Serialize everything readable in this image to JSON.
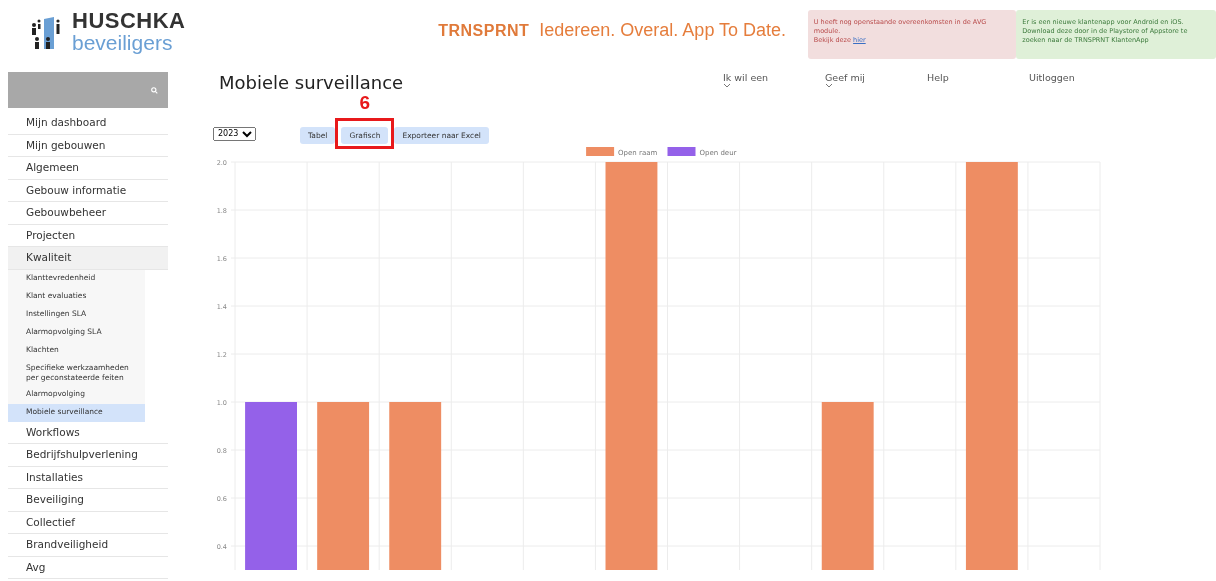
{
  "header": {
    "logo": {
      "name": "HUSCHKA",
      "subtitle": "beveiligers"
    },
    "slogan": {
      "brand": "TRNSPRNT",
      "text": "Iedereen. Overal. App To Date."
    },
    "alerts": [
      {
        "kind": "danger",
        "text": "U heeft nog openstaande overeenkomsten in de AVG module.",
        "link_prefix": "Bekijk deze",
        "link": "hier"
      },
      {
        "kind": "success",
        "text": "Er is een nieuwe klantenapp voor Android en iOS. Download deze door in de Playstore of Appstore te zoeken naar de TRNSPRNT KlantenApp"
      }
    ]
  },
  "sidebar": {
    "items": [
      {
        "label": "Mijn dashboard",
        "selected": false
      },
      {
        "label": "Mijn gebouwen",
        "selected": false
      },
      {
        "label": "Algemeen",
        "selected": false
      },
      {
        "label": "Gebouw informatie",
        "selected": false
      },
      {
        "label": "Gebouwbeheer",
        "selected": false
      },
      {
        "label": "Projecten",
        "selected": false
      },
      {
        "label": "Kwaliteit",
        "selected": false,
        "expanded": true,
        "children": [
          {
            "label": "Klanttevredenheid",
            "selected": false
          },
          {
            "label": "Klant evaluaties",
            "selected": false
          },
          {
            "label": "Instellingen SLA",
            "selected": false
          },
          {
            "label": "Alarmopvolging SLA",
            "selected": false
          },
          {
            "label": "Klachten",
            "selected": false
          },
          {
            "label": "Specifieke werkzaamheden per geconstateerde feiten",
            "selected": false
          },
          {
            "label": "Alarmopvolging",
            "selected": false
          },
          {
            "label": "Mobiele surveillance",
            "selected": true
          }
        ]
      },
      {
        "label": "Workflows",
        "selected": false
      },
      {
        "label": "Bedrijfshulpverlening",
        "selected": false
      },
      {
        "label": "Installaties",
        "selected": false
      },
      {
        "label": "Beveiliging",
        "selected": false
      },
      {
        "label": "Collectief",
        "selected": false
      },
      {
        "label": "Brandveiligheid",
        "selected": false
      },
      {
        "label": "Avg",
        "selected": false
      }
    ]
  },
  "nav": [
    {
      "label": "Ik wil een",
      "dropdown": true
    },
    {
      "label": "Geef mij",
      "dropdown": true
    },
    {
      "label": "Help",
      "dropdown": false
    },
    {
      "label": "Uitloggen",
      "dropdown": false
    }
  ],
  "page": {
    "title": "Mobiele surveillance",
    "year_select": {
      "value": "2023"
    },
    "view_buttons": [
      {
        "label": "Tabel"
      },
      {
        "label": "Grafisch",
        "annotation": "6"
      },
      {
        "label": "Exporteer naar Excel"
      }
    ],
    "chart": {
      "chart_data": {
        "type": "bar",
        "grid": true,
        "legend": "top",
        "ylim": [
          0.3,
          2
        ],
        "yticks": [
          {
            "value": 0.4,
            "label": "0.4"
          },
          {
            "value": 0.6,
            "label": "0.6"
          },
          {
            "value": 0.8,
            "label": "0.8"
          },
          {
            "value": 1,
            "label": "1.0"
          },
          {
            "value": 1.2,
            "label": "1.2"
          },
          {
            "value": 1.4,
            "label": "1.4"
          },
          {
            "value": 1.6,
            "label": "1.6"
          },
          {
            "value": 1.8,
            "label": "1.8"
          },
          {
            "value": 2,
            "label": "2.0"
          }
        ],
        "series": [
          {
            "name": "Open raam",
            "color": "#ee8d63",
            "values": [
              null,
              1,
              1,
              null,
              null,
              2,
              null,
              null,
              1,
              null,
              2,
              null
            ]
          },
          {
            "name": "Open deur",
            "color": "#9461e9",
            "values": [
              1,
              null,
              null,
              null,
              null,
              null,
              null,
              null,
              null,
              null,
              null,
              null
            ]
          }
        ]
      }
    }
  }
}
